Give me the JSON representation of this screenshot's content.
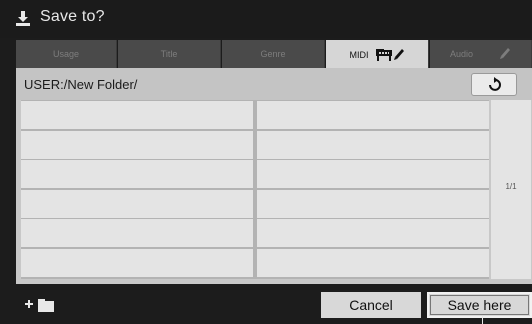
{
  "dialog": {
    "title": "Save to?",
    "icon": "save-tray-icon"
  },
  "tabs": [
    {
      "label": "Usage",
      "active": false
    },
    {
      "label": "Title",
      "active": false
    },
    {
      "label": "Genre",
      "active": false
    },
    {
      "label": "MIDI",
      "active": true,
      "icons": [
        "piano-icon",
        "pencil-icon"
      ]
    },
    {
      "label": "Audio",
      "active": false,
      "icons": [
        "pencil-icon"
      ]
    }
  ],
  "path": {
    "current": "USER:/New Folder/",
    "up_icon": "folder-up-arrow-icon"
  },
  "file_list": {
    "rows": 6,
    "columns": 2,
    "entries": []
  },
  "pagination": {
    "label": "1/1"
  },
  "footer": {
    "new_folder_icon": "new-folder-icon",
    "cancel_label": "Cancel",
    "save_label": "Save here"
  },
  "colors": {
    "background": "#1c1c1c",
    "panel": "#c8c8c8",
    "cell": "#e4e4e4",
    "button": "#d8d8d8",
    "tab_inactive": "#4a4a4a"
  }
}
